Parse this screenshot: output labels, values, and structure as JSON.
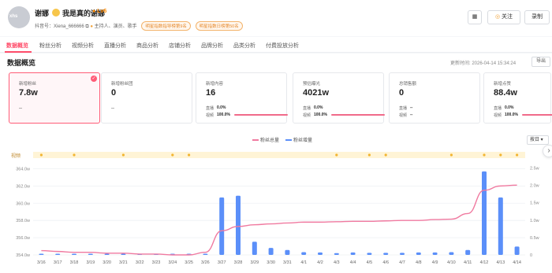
{
  "header": {
    "avatar_text": "xhs",
    "name_prefix": "谢娜",
    "name_suffix": "我是真的谢娜",
    "level": "Lv6",
    "account_label": "抖音号：",
    "account_id": "Xiena_666666",
    "roles": "主持人、演员、歌手",
    "tag1": "明星指数指导榜第9名",
    "tag2": "明星指数日榜第50名",
    "follow_label": "关注",
    "record_label": "录制"
  },
  "tabs": [
    "数据概览",
    "粉丝分析",
    "视频分析",
    "直播分析",
    "商品分析",
    "店铺分析",
    "品牌分析",
    "品类分析",
    "付费投放分析"
  ],
  "panel": {
    "title": "数据概览",
    "updated": "更新时间: 2026-04-14 15:34:24",
    "export_label": "导出"
  },
  "cards": [
    {
      "label": "新增粉丝",
      "value": "7.8w",
      "dash": "--"
    },
    {
      "label": "新增粉丝团",
      "value": "0",
      "dash": "--"
    },
    {
      "label": "新增内容",
      "value": "16",
      "r1_label": "直播",
      "r1_val": "0.0%",
      "r1_fill": 0,
      "r2_label": "视频",
      "r2_val": "100.0%",
      "r2_fill": 1
    },
    {
      "label": "预估曝光",
      "value": "4021w",
      "r1_label": "直播",
      "r1_val": "0.0%",
      "r1_fill": 0,
      "r2_label": "视频",
      "r2_val": "100.0%",
      "r2_fill": 1
    },
    {
      "label": "总销售额",
      "value": "0",
      "r1_label": "直播",
      "r1_val": "--",
      "r1_fill": 0,
      "r2_label": "视频",
      "r2_val": "--",
      "r2_fill": 0
    },
    {
      "label": "新增点赞",
      "value": "88.4w",
      "r1_label": "直播",
      "r1_val": "0.0%",
      "r1_fill": 0,
      "r2_label": "视频",
      "r2_val": "100.0%",
      "r2_fill": 1
    }
  ],
  "legend": {
    "total": "粉丝总量",
    "increase": "粉丝增量"
  },
  "period": "按日",
  "event_label": "视频",
  "colors": {
    "accent": "#ff4d6a",
    "bar": "#5b8ff9",
    "line": "#f07aa0"
  },
  "chart_data": {
    "type": "bar",
    "categories": [
      "3/16",
      "3/17",
      "3/18",
      "3/19",
      "3/20",
      "3/21",
      "3/22",
      "3/23",
      "3/24",
      "3/25",
      "3/26",
      "3/27",
      "3/28",
      "3/29",
      "3/30",
      "3/31",
      "4/1",
      "4/2",
      "4/3",
      "4/4",
      "4/5",
      "4/6",
      "4/7",
      "4/8",
      "4/9",
      "4/10",
      "4/11",
      "4/12",
      "4/13",
      "4/14"
    ],
    "yleft_ticks": [
      "354.0w",
      "356.0w",
      "358.0w",
      "360.0w",
      "362.0w",
      "364.0w"
    ],
    "yright_ticks": [
      "0",
      "0.5w",
      "1.0w",
      "1.5w",
      "2.0w",
      "2.5w"
    ],
    "yleft_lim": [
      354,
      364.5
    ],
    "yright_lim": [
      0,
      2.6
    ],
    "series": [
      {
        "name": "粉丝总量",
        "axis": "left",
        "values": [
          354.5,
          354.4,
          354.3,
          354.3,
          354.2,
          354.2,
          354.1,
          354.1,
          354.0,
          354.0,
          354.3,
          356.8,
          357.3,
          357.5,
          357.6,
          357.7,
          357.8,
          357.8,
          357.85,
          357.9,
          357.9,
          357.95,
          358.0,
          358.0,
          358.1,
          358.15,
          358.8,
          361.5,
          362.0,
          362.1
        ]
      },
      {
        "name": "粉丝增量",
        "axis": "right",
        "values": [
          0.02,
          0.02,
          0.02,
          0.01,
          0.02,
          0.02,
          0.02,
          0.02,
          0.01,
          0.01,
          0.02,
          1.65,
          1.7,
          0.38,
          0.2,
          0.14,
          0.08,
          0.07,
          0.05,
          0.07,
          0.06,
          0.06,
          0.06,
          0.07,
          0.07,
          0.08,
          0.14,
          2.4,
          1.65,
          0.24
        ]
      }
    ],
    "events": [
      "3/16",
      "3/18",
      "3/21",
      "3/24",
      "3/25",
      "4/3",
      "4/5",
      "4/6",
      "4/10",
      "4/12",
      "4/13",
      "4/14"
    ]
  }
}
